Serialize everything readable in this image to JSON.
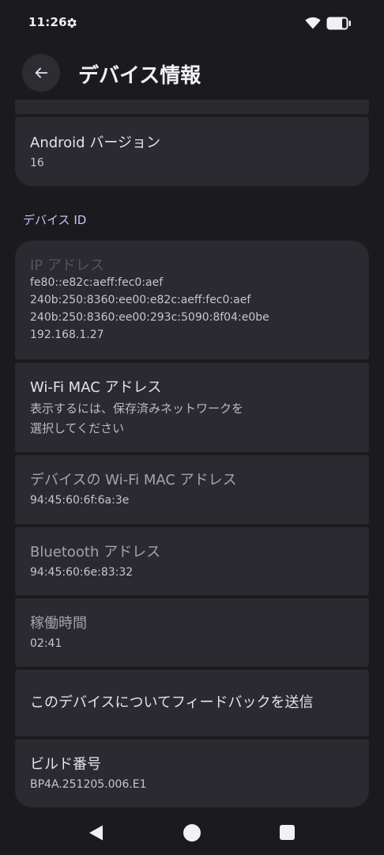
{
  "status_bar": {
    "time": "11:26"
  },
  "app_bar": {
    "title": "デバイス情報"
  },
  "items": {
    "android_version": {
      "title": "Android バージョン",
      "value": "16"
    },
    "section_device_id": "デバイス ID",
    "ip_address": {
      "title": "IP アドレス",
      "values": [
        "fe80::e82c:aeff:fec0:aef",
        "240b:250:8360:ee00:e82c:aeff:fec0:aef",
        "240b:250:8360:ee00:293c:5090:8f04:e0be",
        "192.168.1.27"
      ]
    },
    "wifi_mac": {
      "title": "Wi-Fi MAC アドレス",
      "value_lines": [
        "表示するには、保存済みネットワークを",
        "選択してください"
      ]
    },
    "device_wifi_mac": {
      "title": "デバイスの Wi-Fi MAC アドレス",
      "value": "94:45:60:6f:6a:3e"
    },
    "bluetooth": {
      "title": "Bluetooth アドレス",
      "value": "94:45:60:6e:83:32"
    },
    "uptime": {
      "title": "稼働時間",
      "value": "02:41"
    },
    "feedback": {
      "title": "このデバイスについてフィードバックを送信"
    },
    "build_number": {
      "title": "ビルド番号",
      "value": "BP4A.251205.006.E1"
    }
  },
  "colors": {
    "background": "#1b1b1f",
    "card": "#2b2a30",
    "section_accent": "#c2c5f2"
  }
}
